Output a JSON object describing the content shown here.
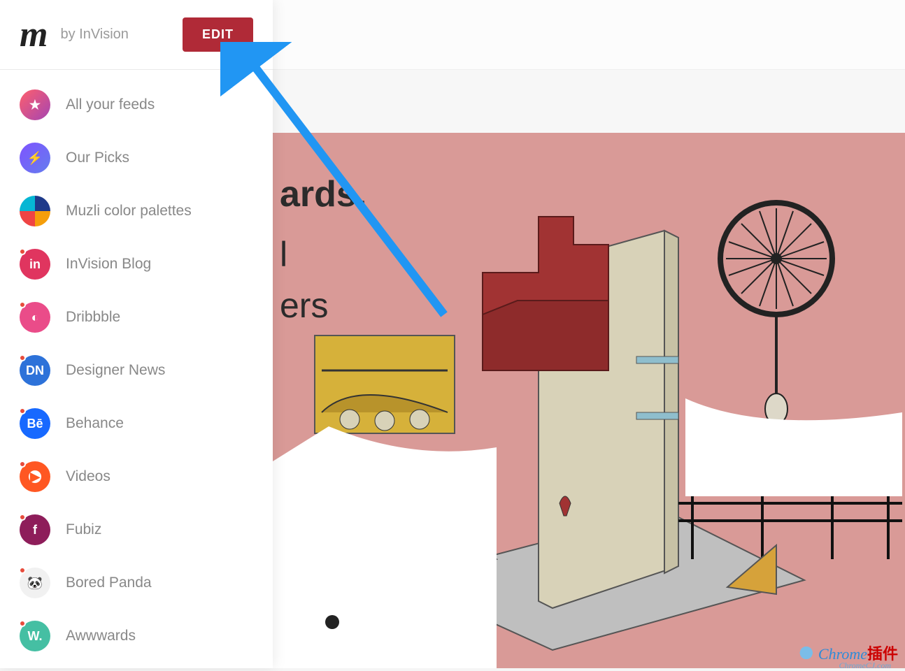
{
  "header": {
    "logo_text": "m",
    "byline": "by InVision",
    "edit_label": "EDIT"
  },
  "sidebar": {
    "items": [
      {
        "label": "All your feeds",
        "icon": "star-icon",
        "bg": "linear-gradient(135deg,#ff5f6d,#a445b2)",
        "glyph": "★",
        "dot": false
      },
      {
        "label": "Our Picks",
        "icon": "bolt-icon",
        "bg": "linear-gradient(135deg,#7f53ff,#647dee)",
        "glyph": "⚡",
        "dot": false
      },
      {
        "label": "Muzli color palettes",
        "icon": "palette-icon",
        "bg": "conic-gradient(#1e3a8a 0 90deg,#f59e0b 90deg 180deg,#ef4444 180deg 270deg,#06b6d4 270deg 360deg)",
        "glyph": "",
        "dot": false
      },
      {
        "label": "InVision Blog",
        "icon": "invision-icon",
        "bg": "#e0355f",
        "glyph": "in",
        "dot": true
      },
      {
        "label": "Dribbble",
        "icon": "dribbble-icon",
        "bg": "#ea4c89",
        "glyph": "◐",
        "dot": true
      },
      {
        "label": "Designer News",
        "icon": "designer-news-icon",
        "bg": "#2d72d9",
        "glyph": "DN",
        "dot": true
      },
      {
        "label": "Behance",
        "icon": "behance-icon",
        "bg": "#1769ff",
        "glyph": "Bē",
        "dot": true
      },
      {
        "label": "Videos",
        "icon": "videos-icon",
        "bg": "radial-gradient(circle,#fff 28%,#ff5722 30%)",
        "glyph": "▶",
        "dot": true
      },
      {
        "label": "Fubiz",
        "icon": "fubiz-icon",
        "bg": "#8e1d5a",
        "glyph": "f",
        "dot": true
      },
      {
        "label": "Bored Panda",
        "icon": "bored-panda-icon",
        "bg": "#f1f1f1",
        "glyph": "🐼",
        "dot": true
      },
      {
        "label": "Awwwards",
        "icon": "awwwards-icon",
        "bg": "#45bfa3",
        "glyph": "W.",
        "dot": true
      }
    ]
  },
  "hero": {
    "title_fragment": "ards.",
    "line2_fragment": "l",
    "line3_fragment": "ers"
  },
  "watermark": {
    "brand": "Chrome",
    "brand_cn": "插件",
    "sub": "ChromeCJ.com"
  },
  "colors": {
    "edit_button": "#b02a37",
    "hero_bg": "#d99a97",
    "arrow": "#2196f3"
  }
}
